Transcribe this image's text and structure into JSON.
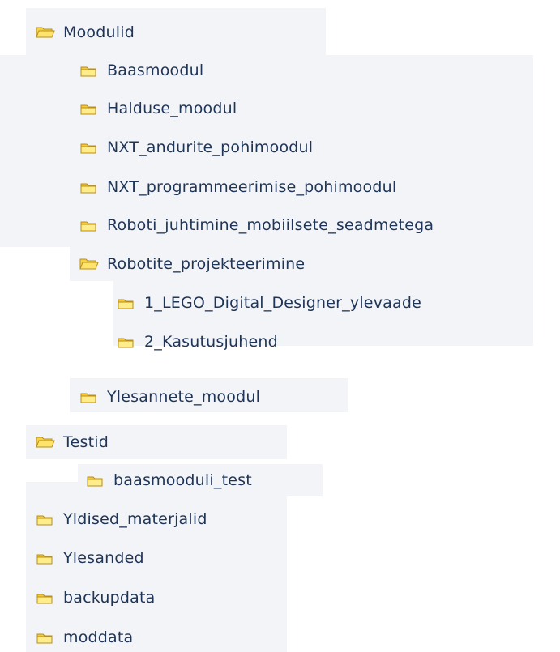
{
  "tree": {
    "root_moodulid": {
      "label": "Moodulid",
      "icon": "folder-open-icon"
    },
    "baasmoodul": {
      "label": "Baasmoodul",
      "icon": "folder-closed-icon"
    },
    "halduse_moodul": {
      "label": "Halduse_moodul",
      "icon": "folder-closed-icon"
    },
    "nxt_andurite": {
      "label": "NXT_andurite_pohimoodul",
      "icon": "folder-closed-icon"
    },
    "nxt_programmeerimise": {
      "label": "NXT_programmeerimise_pohimoodul",
      "icon": "folder-closed-icon"
    },
    "roboti_juhtimine": {
      "label": "Roboti_juhtimine_mobiilsete_seadmetega",
      "icon": "folder-closed-icon"
    },
    "robotite_projekteerimine": {
      "label": "Robotite_projekteerimine",
      "icon": "folder-open-icon"
    },
    "lego_digital": {
      "label": "1_LEGO_Digital_Designer_ylevaade",
      "icon": "folder-closed-icon"
    },
    "kasutusjuhend": {
      "label": "2_Kasutusjuhend",
      "icon": "folder-closed-icon"
    },
    "ylesannete_moodul": {
      "label": "Ylesannete_moodul",
      "icon": "folder-closed-icon"
    },
    "root_testid": {
      "label": "Testid",
      "icon": "folder-open-icon"
    },
    "baasmooduli_test": {
      "label": "baasmooduli_test",
      "icon": "folder-closed-icon"
    },
    "yldised_materjalid": {
      "label": "Yldised_materjalid",
      "icon": "folder-closed-icon"
    },
    "ylesanded": {
      "label": "Ylesanded",
      "icon": "folder-closed-icon"
    },
    "backupdata": {
      "label": "backupdata",
      "icon": "folder-closed-icon"
    },
    "moddata": {
      "label": "moddata",
      "icon": "folder-closed-icon"
    }
  },
  "colors": {
    "label_text": "#1f3557",
    "row_background": "#f2f4f8",
    "folder_fill": "#f6d24a",
    "folder_fill_light": "#ffec8a",
    "folder_outline": "#b98f16"
  }
}
